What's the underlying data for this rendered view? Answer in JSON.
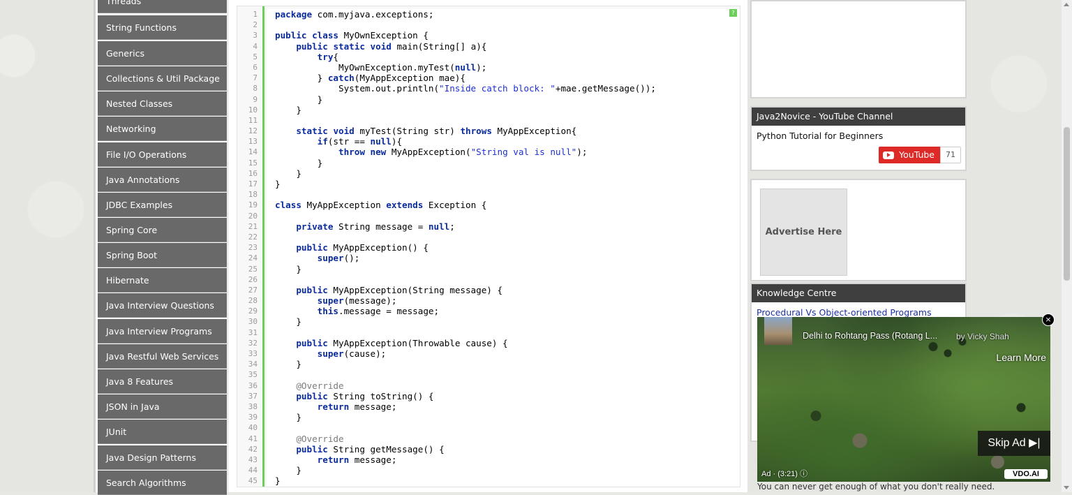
{
  "sidebar": {
    "items": [
      {
        "label": "Threads"
      },
      {
        "label": "String Functions"
      },
      {
        "label": "Generics"
      },
      {
        "label": "Collections & Util Package"
      },
      {
        "label": "Nested Classes"
      },
      {
        "label": "Networking"
      },
      {
        "label": "File I/O Operations"
      },
      {
        "label": "Java Annotations"
      },
      {
        "label": "JDBC Examples"
      },
      {
        "label": "Spring Core"
      },
      {
        "label": "Spring Boot"
      },
      {
        "label": "Hibernate"
      },
      {
        "label": "Java Interview Questions"
      },
      {
        "label": "Java Interview Programs"
      },
      {
        "label": "Java Restful Web Services"
      },
      {
        "label": "Java 8 Features"
      },
      {
        "label": "JSON in Java"
      },
      {
        "label": "JUnit"
      },
      {
        "label": "Java Design Patterns"
      },
      {
        "label": "Search Algorithms"
      }
    ]
  },
  "code": {
    "help_icon": "?",
    "lines": [
      "package com.myjava.exceptions;",
      "",
      "public class MyOwnException {",
      "    public static void main(String[] a){",
      "        try{",
      "            MyOwnException.myTest(null);",
      "        } catch(MyAppException mae){",
      "            System.out.println(\"Inside catch block: \"+mae.getMessage());",
      "        }",
      "    }",
      "",
      "    static void myTest(String str) throws MyAppException{",
      "        if(str == null){",
      "            throw new MyAppException(\"String val is null\");",
      "        }",
      "    }",
      "}",
      "",
      "class MyAppException extends Exception {",
      "",
      "    private String message = null;",
      "",
      "    public MyAppException() {",
      "        super();",
      "    }",
      "",
      "    public MyAppException(String message) {",
      "        super(message);",
      "        this.message = message;",
      "    }",
      "",
      "    public MyAppException(Throwable cause) {",
      "        super(cause);",
      "    }",
      "",
      "    @Override",
      "    public String toString() {",
      "        return message;",
      "    }",
      "",
      "    @Override",
      "    public String getMessage() {",
      "        return message;",
      "    }",
      "}"
    ],
    "keywords": [
      "package",
      "public",
      "class",
      "static",
      "void",
      "try",
      "catch",
      "null",
      "throws",
      "if",
      "throw",
      "new",
      "extends",
      "private",
      "super",
      "this",
      "return"
    ]
  },
  "youtube_panel": {
    "header": "Java2Novice - YouTube Channel",
    "text": "Python Tutorial for Beginners",
    "button_label": "YouTube",
    "count": "71"
  },
  "advertise": {
    "label": "Advertise Here"
  },
  "knowledge_centre": {
    "header": "Knowledge Centre",
    "link": "Procedural Vs Object-oriented Programs"
  },
  "video_ad": {
    "title": "Delhi to Rohtang Pass (Rotang L...",
    "by": "by Vicky Shah",
    "learn_more": "Learn More",
    "skip": "Skip Ad ▶|",
    "info": "Ad · (3:21)  ⓘ",
    "brand": "VDO.AI",
    "close": "×"
  },
  "below_ad_text": "You can never get enough of what you don't really need."
}
